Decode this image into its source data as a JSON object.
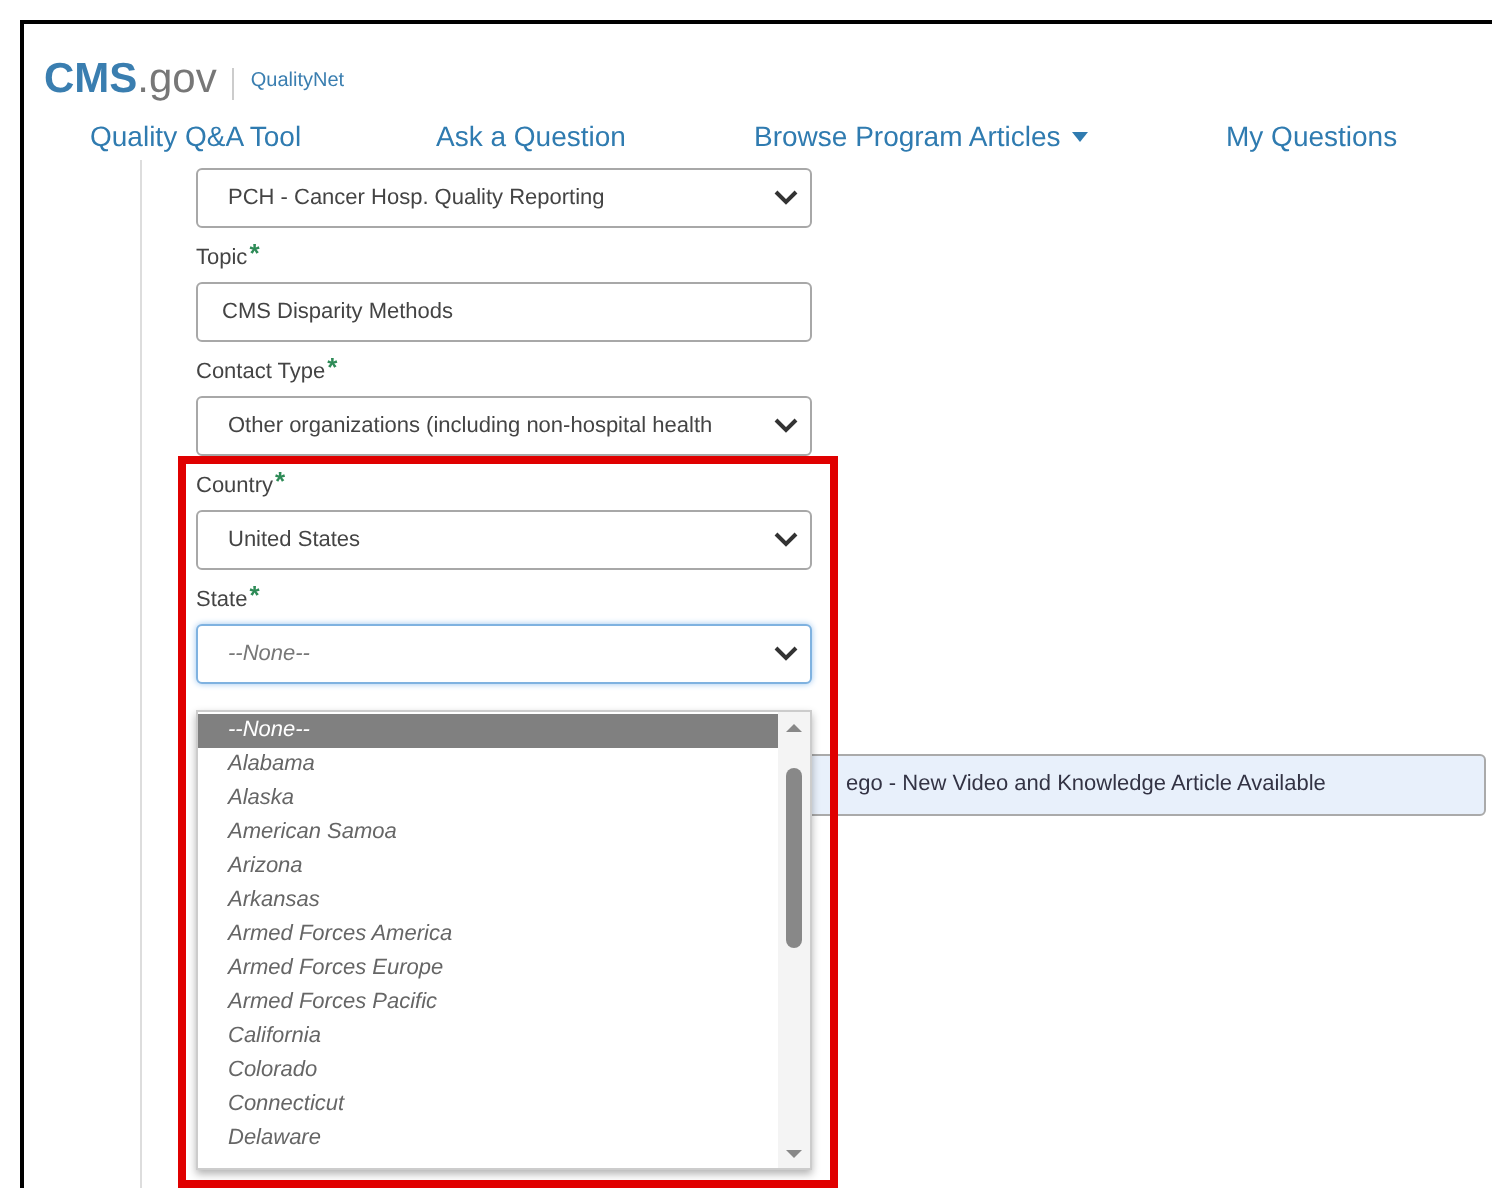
{
  "logo": {
    "brand": "CMS",
    "suffix": ".gov",
    "product": "QualityNet"
  },
  "nav": [
    {
      "label": "Quality Q&A Tool",
      "kind": "link"
    },
    {
      "label": "Ask a Question",
      "kind": "link"
    },
    {
      "label": "Browse Program Articles",
      "kind": "dropdown"
    },
    {
      "label": "My Questions",
      "kind": "link"
    }
  ],
  "fields": [
    {
      "kind": "select",
      "value": "PCH - Cancer Hosp. Quality Reporting",
      "focused": false
    },
    {
      "kind": "input",
      "label": "Topic",
      "required_mark": "*",
      "value": "CMS Disparity Methods",
      "focused": false
    },
    {
      "kind": "select",
      "label": "Contact Type",
      "required_mark": "*",
      "value": "Other organizations (including non-hospital health",
      "focused": false
    },
    {
      "kind": "select",
      "label": "Country",
      "required_mark": "*",
      "value": "United States",
      "focused": false
    },
    {
      "kind": "select",
      "label": "State",
      "required_mark": "*",
      "placeholder": "--None--",
      "focused": true
    }
  ],
  "state_options": [
    {
      "label": "--None--",
      "selected": true
    },
    {
      "label": "Alabama",
      "selected": false
    },
    {
      "label": "Alaska",
      "selected": false
    },
    {
      "label": "American Samoa",
      "selected": false
    },
    {
      "label": "Arizona",
      "selected": false
    },
    {
      "label": "Arkansas",
      "selected": false
    },
    {
      "label": "Armed Forces America",
      "selected": false
    },
    {
      "label": "Armed Forces Europe",
      "selected": false
    },
    {
      "label": "Armed Forces Pacific",
      "selected": false
    },
    {
      "label": "California",
      "selected": false
    },
    {
      "label": "Colorado",
      "selected": false
    },
    {
      "label": "Connecticut",
      "selected": false
    },
    {
      "label": "Delaware",
      "selected": false
    }
  ],
  "article_banner": "ego - New Video and Knowledge Article Available"
}
